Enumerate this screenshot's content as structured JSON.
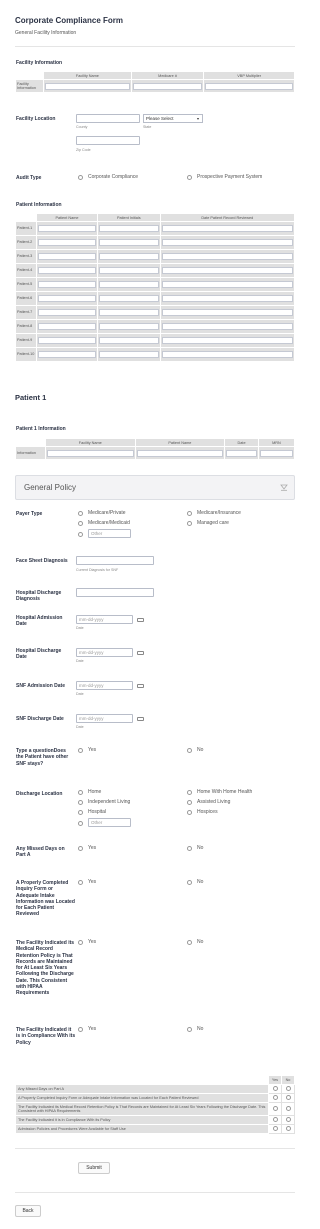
{
  "header": {
    "title": "Corporate Compliance Form",
    "subtitle": "General Facility Information"
  },
  "facility_info": {
    "label": "Facility Information",
    "columns": [
      "Facility Name",
      "Medicare #",
      "VBP Multiplier"
    ],
    "row_label": "Facility Information"
  },
  "facility_location": {
    "label": "Facility Location",
    "county_sub": "County",
    "state_placeholder": "Please Select",
    "state_sub": "State",
    "zip_sub": "Zip Code"
  },
  "audit_type": {
    "label": "Audit Type",
    "options": [
      "Corporate Compliance",
      "Prospective Payment System"
    ]
  },
  "patient_info": {
    "label": "Patient Information",
    "columns": [
      "Patient Name",
      "Patient Initials",
      "Date Patient Record Reviewed"
    ],
    "rows": [
      "Patient-1",
      "Patient-2",
      "Patient-3",
      "Patient-4",
      "Patient-5",
      "Patient-6",
      "Patient-7",
      "Patient-8",
      "Patient-9",
      "Patient-10"
    ]
  },
  "patient1": {
    "heading": "Patient 1",
    "info_label": "Patient 1 Information",
    "columns": [
      "Facility Name",
      "Patient Name",
      "Date",
      "MRN"
    ],
    "row_label": "Information"
  },
  "general_policy": {
    "title": "General Policy"
  },
  "payer_type": {
    "label": "Payer Type",
    "options": [
      "Medicare/Private",
      "Medicare/Insurance",
      "Medicare/Medicaid",
      "Managed care"
    ],
    "other_placeholder": "Other"
  },
  "face_sheet": {
    "label": "Face Sheet Diagnosis",
    "sub": "Current Diagnosis for SNF"
  },
  "hospital_discharge_diagnosis": {
    "label": "Hospital Discharge Diagnosis"
  },
  "dates": [
    {
      "label": "Hospital Admission Date",
      "placeholder": "mm-dd-yyyy",
      "sub": "Date"
    },
    {
      "label": "Hospital Discharge Date",
      "placeholder": "mm-dd-yyyy",
      "sub": "Date"
    },
    {
      "label": "SNF Admission Date",
      "placeholder": "mm-dd-yyyy",
      "sub": "Date"
    },
    {
      "label": "SNF Discharge Date",
      "placeholder": "mm-dd-yyyy",
      "sub": "Date"
    }
  ],
  "other_snf": {
    "label": "Type a questionDoes the Patient have other SNF stays?",
    "yes": "Yes",
    "no": "No"
  },
  "discharge_location": {
    "label": "Discharge Location",
    "options": [
      "Home",
      "Home With Home Health",
      "Independent Living",
      "Assisted Living",
      "Hospital",
      "Hospices"
    ],
    "other_placeholder": "Other"
  },
  "yesno_questions": [
    {
      "label": "Any Missed Days on Part A",
      "yes": "Yes",
      "no": "No"
    },
    {
      "label": "A Properly Completed Inquiry Form or Adequate Intake Information was Located for Each Patient Reviewed",
      "yes": "Yes",
      "no": "No"
    },
    {
      "label": "The Facility Indicated its Medical Record Retention Policy is That Records are Maintained for At Least Six Years Following the Discharge Date. This Consistent with HIPAA Requirements",
      "yes": "Yes",
      "no": "No"
    },
    {
      "label": "The Facility Indicated it is in Compliance With its Policy",
      "yes": "Yes",
      "no": "No"
    }
  ],
  "matrix": {
    "columns": [
      "Yes",
      "No"
    ],
    "rows": [
      "Any Missed Days on Part A",
      "A Properly Completed Inquiry Form or Adequate Intake Information was Located for Each Patient Reviewed",
      "The Facility Indicated its Medical Record Retention Policy is That Records are Maintained for At Least Six Years Following the Discharge Date. This Consistent with HIPAA Requirements",
      "The Facility Indicated it is in Compliance With its Policy",
      "Admission Policies and Procedures Were Available for Staff Use"
    ]
  },
  "buttons": {
    "submit": "Submit",
    "back": "Back"
  }
}
